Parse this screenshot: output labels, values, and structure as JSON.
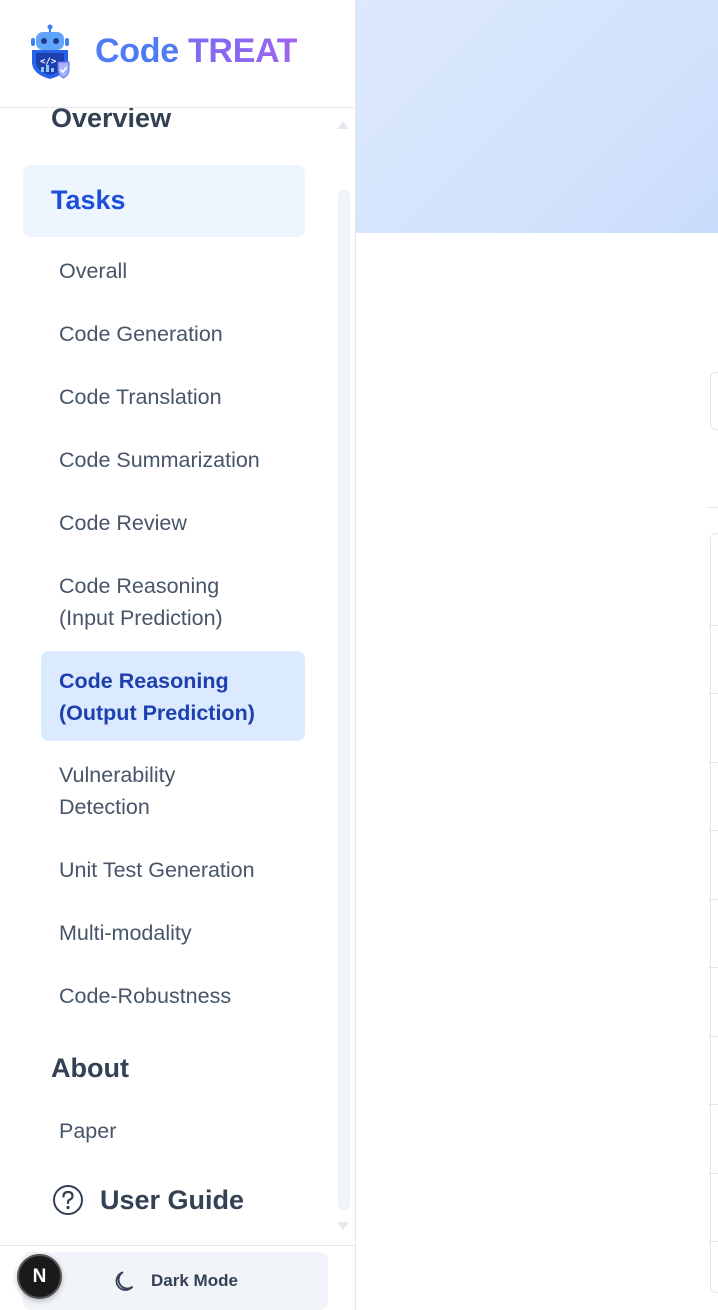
{
  "brand": {
    "name_a": "Code",
    "name_b": "TREAT",
    "icon": "robot-shield-icon"
  },
  "nav": {
    "overview": "Overview",
    "tasks": "Tasks",
    "task_items": [
      "Overall",
      "Code Generation",
      "Code Translation",
      "Code Summarization",
      "Code Review",
      "Code Reasoning (Input Prediction)",
      "Code Reasoning (Output Prediction)",
      "Vulnerability Detection",
      "Unit Test Generation",
      "Multi-modality",
      "Code-Robustness"
    ],
    "active_item": "Code Reasoning (Output Prediction)",
    "about": "About",
    "about_items": [
      "Paper"
    ],
    "user_guide": "User Guide"
  },
  "footer": {
    "dark_mode": "Dark Mode",
    "badge": "N"
  },
  "colors": {
    "accent": "#1d4ed8",
    "active_bg": "#dbeafe",
    "tasks_bg": "#eff5ff",
    "hero": "#d3e3fc"
  }
}
